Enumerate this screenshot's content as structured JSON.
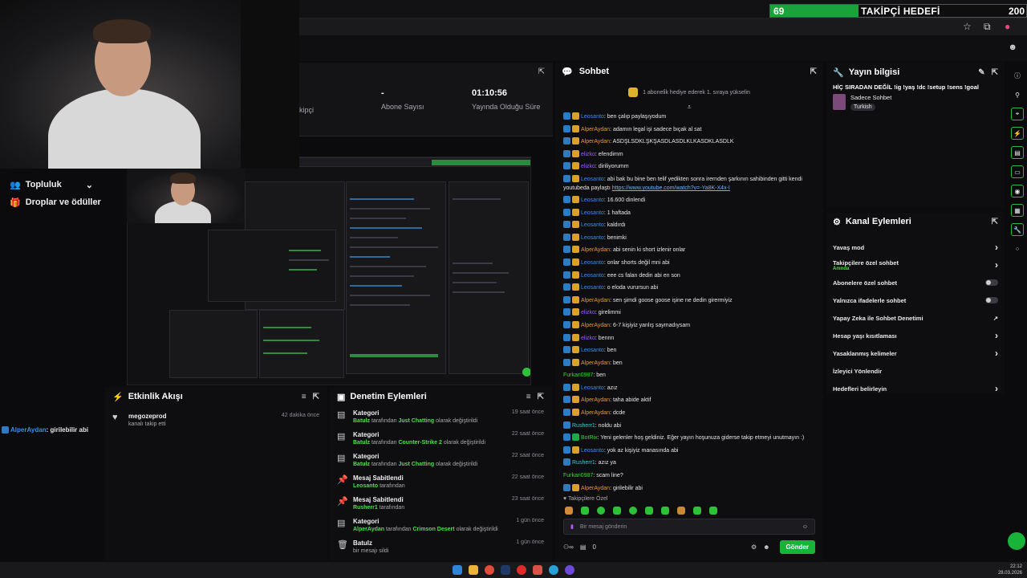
{
  "goal": {
    "current": "69",
    "label": "TAKİPÇİ HEDEFİ",
    "target": "200",
    "fill_fraction": 0.345
  },
  "left_rail": {
    "items": [
      {
        "label": "Topluluk"
      },
      {
        "label": "Droplar ve ödüller"
      }
    ]
  },
  "overlay_chat": {
    "user": "AlperAydan",
    "text": ": girilebilir abi"
  },
  "stats": {
    "first_label": "kipçi",
    "subs_value": "-",
    "subs_label": "Abone Sayısı",
    "uptime_value": "01:10:56",
    "uptime_label": "Yayında Olduğu Süre"
  },
  "activity": {
    "title": "Etkinlik Akışı",
    "items": [
      {
        "user": "megozeprod",
        "text": "kanalı takip etti",
        "time": "42 dakika önce"
      }
    ]
  },
  "modlog": {
    "title": "Denetim Eylemleri",
    "items": [
      {
        "title": "Kategori",
        "actor": "Batulz",
        "mid": "tarafından",
        "value": "Just Chatting",
        "suffix": "olarak değiştirildi",
        "time": "19 saat önce"
      },
      {
        "title": "Kategori",
        "actor": "Batulz",
        "mid": "tarafından",
        "value": "Counter-Strike 2",
        "suffix": "olarak değiştirildi",
        "time": "22 saat önce"
      },
      {
        "title": "Kategori",
        "actor": "Batulz",
        "mid": "tarafından",
        "value": "Just Chatting",
        "suffix": "olarak değiştirildi",
        "time": "22 saat önce"
      },
      {
        "title": "Mesaj Sabitlendi",
        "actor": "Leosanto",
        "mid": "tarafından",
        "value": "",
        "suffix": "",
        "time": "22 saat önce"
      },
      {
        "title": "Mesaj Sabitlendi",
        "actor": "Rusherr1",
        "mid": "tarafından",
        "value": "",
        "suffix": "",
        "time": "23 saat önce"
      },
      {
        "title": "Kategori",
        "actor": "AlperAydan",
        "mid": "tarafından",
        "value": "Crimson Desert",
        "suffix": "olarak değiştirildi",
        "time": "1 gün önce"
      },
      {
        "title": "Batulz",
        "actor": "",
        "mid": "bir mesajı sildi",
        "value": "",
        "suffix": "",
        "time": "1 gün önce"
      }
    ]
  },
  "chat": {
    "title": "Sohbet",
    "banner": "1 aboneli̇k hediye ederek 1. sıraya yükselin",
    "messages": [
      {
        "user": "Leosanto",
        "color": "u-blue",
        "badges": [
          "b-blue",
          "b-gold"
        ],
        "text": ": ben çalıp paylaşıyodum"
      },
      {
        "user": "AlperAydan",
        "color": "u-orange",
        "badges": [
          "b-blue",
          "b-gold"
        ],
        "text": ": adamın legal işi sadece bıçak al sat"
      },
      {
        "user": "AlperAydan",
        "color": "u-orange",
        "badges": [
          "b-blue",
          "b-gold"
        ],
        "text": ": ASDŞLSDKLŞKŞASDLASDLKLKASDKLASDLK"
      },
      {
        "user": "elizko",
        "color": "u-purple",
        "badges": [
          "b-blue",
          "b-gold"
        ],
        "text": ": efendimm"
      },
      {
        "user": "elizko",
        "color": "u-purple",
        "badges": [
          "b-blue",
          "b-gold"
        ],
        "text": ": diriliyorumm"
      },
      {
        "user": "Leosanto",
        "color": "u-blue",
        "badges": [
          "b-blue",
          "b-gold"
        ],
        "text": ": abi bak bu bine ben telif yedikten sonra irernden şarkının sahibinden gitti kendi youtubeda paylaştı",
        "link": "https://www.youtube.com/watch?v=-Ya8K-X4x-I",
        "wrap": true
      },
      {
        "user": "Leosanto",
        "color": "u-blue",
        "badges": [
          "b-blue",
          "b-gold"
        ],
        "text": ": 16.600 dinlendi"
      },
      {
        "user": "Leosanto",
        "color": "u-blue",
        "badges": [
          "b-blue",
          "b-gold"
        ],
        "text": ": 1 haftada"
      },
      {
        "user": "Leosanto",
        "color": "u-blue",
        "badges": [
          "b-blue",
          "b-gold"
        ],
        "text": ": kaldırdı"
      },
      {
        "user": "Leosanto",
        "color": "u-blue",
        "badges": [
          "b-blue",
          "b-gold"
        ],
        "text": ": benimki"
      },
      {
        "user": "AlperAydan",
        "color": "u-orange",
        "badges": [
          "b-blue",
          "b-gold"
        ],
        "text": ": abi senin ki short izlenir onlar"
      },
      {
        "user": "Leosanto",
        "color": "u-blue",
        "badges": [
          "b-blue",
          "b-gold"
        ],
        "text": ": onlar shorts değil mni abi"
      },
      {
        "user": "Leosanto",
        "color": "u-blue",
        "badges": [
          "b-blue",
          "b-gold"
        ],
        "text": ": eee cs falan dedin abi en son"
      },
      {
        "user": "Leosanto",
        "color": "u-blue",
        "badges": [
          "b-blue",
          "b-gold"
        ],
        "text": ": o eloda vurursun abi"
      },
      {
        "user": "AlperAydan",
        "color": "u-orange",
        "badges": [
          "b-blue",
          "b-gold"
        ],
        "text": ": sen şimdi goose goose işine ne dedin girermiyiz"
      },
      {
        "user": "elizko",
        "color": "u-purple",
        "badges": [
          "b-blue",
          "b-gold"
        ],
        "text": ": girelimmi"
      },
      {
        "user": "AlperAydan",
        "color": "u-orange",
        "badges": [
          "b-blue",
          "b-gold"
        ],
        "text": ": 6-7 kişiyiz yanlış saymadıysam"
      },
      {
        "user": "elizko",
        "color": "u-purple",
        "badges": [
          "b-blue",
          "b-gold"
        ],
        "text": ": bennn"
      },
      {
        "user": "Leosanto",
        "color": "u-blue",
        "badges": [
          "b-blue",
          "b-gold"
        ],
        "text": ": ben"
      },
      {
        "user": "AlperAydan",
        "color": "u-orange",
        "badges": [
          "b-blue",
          "b-gold"
        ],
        "text": ": ben"
      },
      {
        "user": "Furkan0987",
        "color": "u-green",
        "badges": [],
        "text": ": ben"
      },
      {
        "user": "Leosanto",
        "color": "u-blue",
        "badges": [
          "b-blue",
          "b-gold"
        ],
        "text": ": azız"
      },
      {
        "user": "AlperAydan",
        "color": "u-orange",
        "badges": [
          "b-blue",
          "b-gold"
        ],
        "text": ": taha abide aktif"
      },
      {
        "user": "AlperAydan",
        "color": "u-orange",
        "badges": [
          "b-blue",
          "b-gold"
        ],
        "text": ": dcde"
      },
      {
        "user": "Rusherr1",
        "color": "u-cyan",
        "badges": [
          "b-blue"
        ],
        "text": ": noldu abi"
      },
      {
        "user": "BotRix",
        "color": "u-green",
        "badges": [
          "b-blue",
          "b-green"
        ],
        "text": ": Yeni gelenler hoş geldiniz. Eğer yayın hoşunuza giderse takip etmeyi unutmayın :)"
      },
      {
        "user": "Leosanto",
        "color": "u-blue",
        "badges": [
          "b-blue",
          "b-gold"
        ],
        "text": ": yok az kişiyiz manasında abi"
      },
      {
        "user": "Rusherr1",
        "color": "u-cyan",
        "badges": [
          "b-blue"
        ],
        "text": ": azız ya"
      },
      {
        "user": "Furkan0987",
        "color": "u-green",
        "badges": [],
        "text": ": scam line?"
      },
      {
        "user": "AlperAydan",
        "color": "u-orange",
        "badges": [
          "b-blue",
          "b-gold"
        ],
        "text": ": girilebilir abi"
      }
    ],
    "followers_only": "Takipçilere Özel",
    "input_placeholder": "Bir mesaj gönderin",
    "footer_count": "0",
    "send_label": "Gönder"
  },
  "stream_info": {
    "title": "Yayın bilgisi",
    "stream_title": "HİÇ SIRADAN DEĞİL !ig !yaş !dc !setup !sens !goal",
    "category": "Sadece Sohbet",
    "tag": "Turkish"
  },
  "channel_actions": {
    "title": "Kanal Eylemleri",
    "rows": [
      {
        "label": "Yavaş mod",
        "sub": "",
        "control": "chevron"
      },
      {
        "label": "Takipçilere özel sohbet",
        "sub": "Anında",
        "control": "chevron"
      },
      {
        "label": "Abonelere özel sohbet",
        "sub": "",
        "control": "toggle"
      },
      {
        "label": "Yalnızca ifadelerle sohbet",
        "sub": "",
        "control": "toggle"
      },
      {
        "label": "Yapay Zeka ile Sohbet Denetimi",
        "sub": "",
        "control": "external"
      },
      {
        "label": "Hesap yaşı kısıtlaması",
        "sub": "",
        "control": "chevron"
      },
      {
        "label": "Yasaklanmış kelimeler",
        "sub": "",
        "control": "chevron"
      },
      {
        "label": "İzleyici Yönlendir",
        "sub": "",
        "control": "none"
      },
      {
        "label": "Hedefleri belirleyin",
        "sub": "",
        "control": "chevron"
      }
    ]
  },
  "taskbar": {
    "time": "22:12",
    "date": "28.03.2026"
  }
}
